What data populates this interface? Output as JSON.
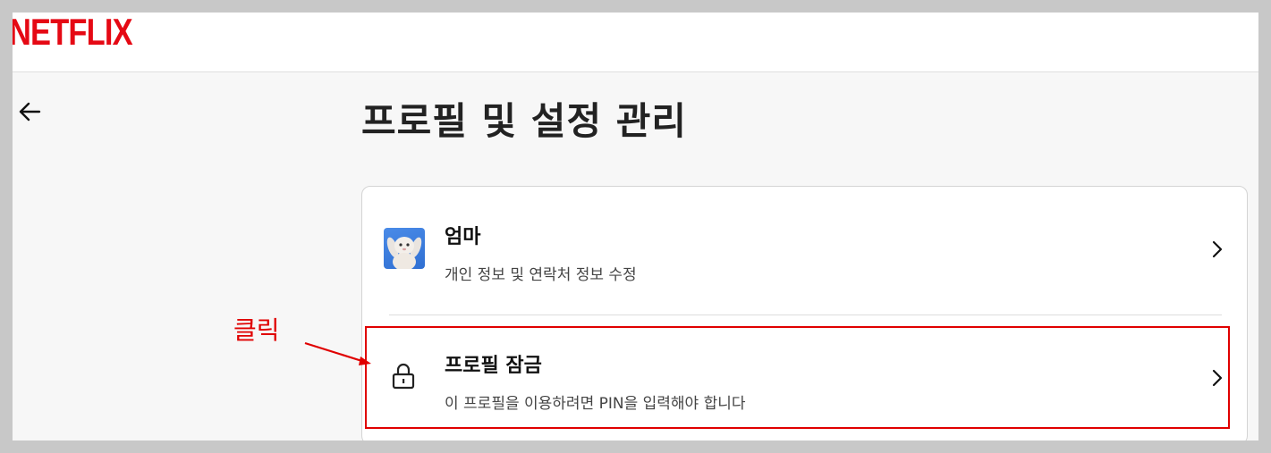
{
  "brand": {
    "logo_text": "NETFLIX",
    "color": "#e50914"
  },
  "page": {
    "title": "프로필 및 설정 관리",
    "back_icon": "arrow-left-icon"
  },
  "profile": {
    "name": "엄마",
    "subtitle": "개인 정보 및 연락처 정보 수정",
    "avatar_icon": "bunny-avatar-icon"
  },
  "lock": {
    "title": "프로필 잠금",
    "subtitle": "이 프로필을 이용하려면 PIN을 입력해야 합니다",
    "icon": "lock-icon"
  },
  "annotation": {
    "label": "클릭",
    "color": "#e00000"
  }
}
